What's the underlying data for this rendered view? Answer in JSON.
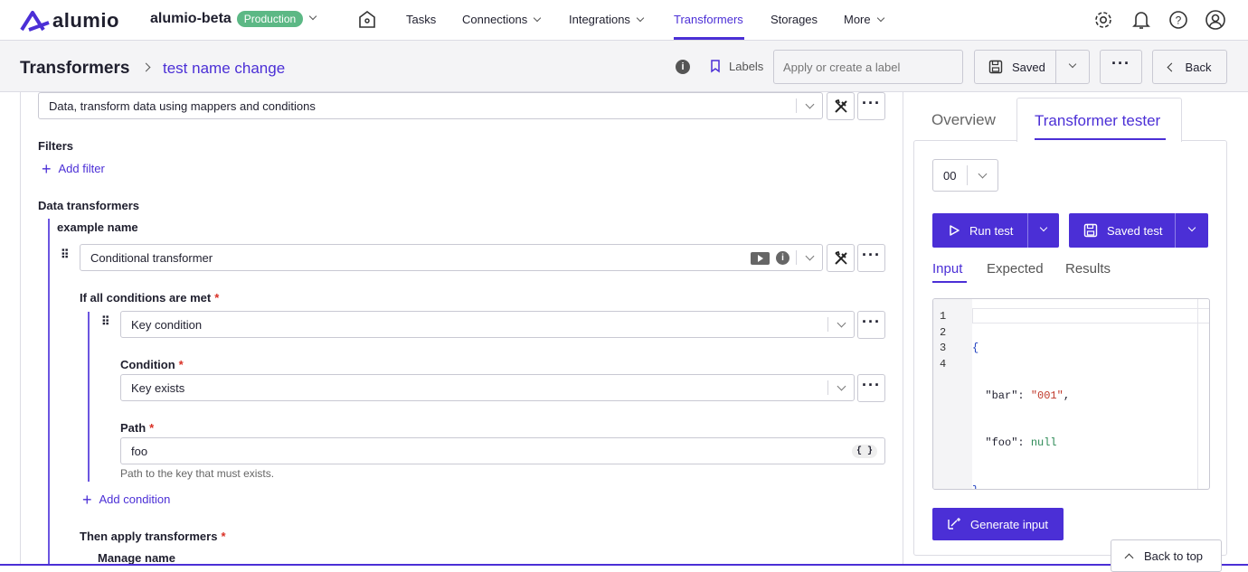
{
  "brand": {
    "name": "alumio",
    "instance": "alumio-beta",
    "env_badge": "Production"
  },
  "nav": {
    "tasks": "Tasks",
    "connections": "Connections",
    "integrations": "Integrations",
    "transformers": "Transformers",
    "storages": "Storages",
    "more": "More"
  },
  "header": {
    "section": "Transformers",
    "item": "test name change",
    "labels": "Labels",
    "label_placeholder": "Apply or create a label",
    "saved": "Saved",
    "back": "Back"
  },
  "form": {
    "type_value": "Data, transform data using mappers and conditions",
    "filters_label": "Filters",
    "add_filter": "Add filter",
    "data_transformers_label": "Data transformers",
    "transformer_name": "example name",
    "transformer_type": "Conditional transformer",
    "conditions_label": "If all conditions are met",
    "condition_type": "Key condition",
    "condition_label": "Condition",
    "condition_value": "Key exists",
    "path_label": "Path",
    "path_value": "foo",
    "path_brace": "{ }",
    "path_help": "Path to the key that must exists.",
    "add_condition": "Add condition",
    "then_label": "Then apply transformers",
    "manage_name": "Manage name",
    "required_mark": "*"
  },
  "tester": {
    "tab_overview": "Overview",
    "tab_tester": "Transformer tester",
    "test_select": "00",
    "run_test": "Run test",
    "saved_test": "Saved test",
    "subtab_input": "Input",
    "subtab_expected": "Expected",
    "subtab_results": "Results",
    "line_numbers": [
      "1",
      "2",
      "3",
      "4"
    ],
    "code": {
      "l1": "{",
      "key_bar": "\"bar\"",
      "colon": ": ",
      "val_bar": "\"001\"",
      "comma": ",",
      "key_foo": "\"foo\"",
      "val_foo": "null",
      "l4": "}"
    },
    "generate_input": "Generate input",
    "back_to_top": "Back to top"
  },
  "colors": {
    "accent": "#4b2fd6",
    "badge": "#5cb885",
    "required": "#d93025",
    "string": "#c0392b",
    "null": "#2e8b57"
  }
}
